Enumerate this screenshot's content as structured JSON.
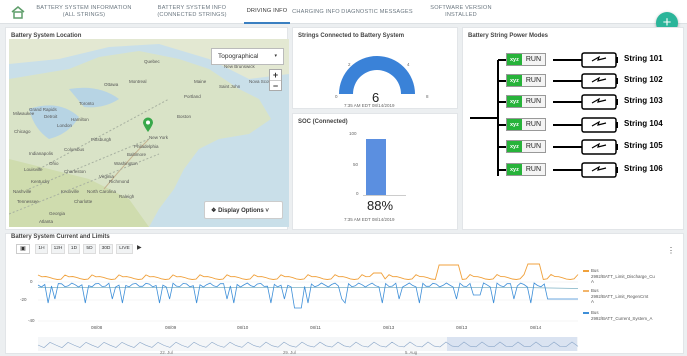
{
  "tabs": [
    {
      "label_1": "BATTERY SYSTEM INFORMATION",
      "label_2": "(ALL STRINGS)"
    },
    {
      "label_1": "BATTERY SYSTEM INFO",
      "label_2": "(CONNECTED STRINGS)"
    },
    {
      "label_1": "DRIVING INFO",
      "label_2": ""
    },
    {
      "label_1": "CHARGING INFO",
      "label_2": ""
    },
    {
      "label_1": "DIAGNOSTIC MESSAGES",
      "label_2": ""
    },
    {
      "label_1": "SOFTWARE VERSION INSTALLED",
      "label_2": ""
    }
  ],
  "fab_label": "+",
  "map_panel": {
    "title": "Battery System Location",
    "map_type": "Topographical",
    "zoom_in": "+",
    "zoom_out": "−",
    "display_options": "Display Options",
    "places": [
      "Toronto",
      "Ottawa",
      "Montreal",
      "Portland",
      "Boston",
      "New York",
      "Philadelphia",
      "Detroit",
      "Chicago",
      "Indianapolis",
      "Columbus",
      "Pittsburgh",
      "Washington",
      "Virginia",
      "North Carolina",
      "Ohio",
      "Kentucky",
      "Tennessee",
      "Georgia",
      "Louisville",
      "Baltimore",
      "Nashville",
      "Atlanta",
      "Charlotte",
      "Richmond",
      "Charleston",
      "Raleigh",
      "New Brunswick",
      "Nova Scotia",
      "Saint John",
      "Quebec",
      "Hamilton",
      "London",
      "Grand Rapids",
      "Milwaukee",
      "Maine",
      "Knoxville"
    ]
  },
  "strings_panel": {
    "title": "Strings Connected to Battery System",
    "value": "6",
    "gauge_ticks": [
      "0",
      "2",
      "4",
      "8"
    ],
    "timestamp": "7:35 AM EDT 08/14/2019"
  },
  "soc_panel": {
    "title": "SOC (Connected)",
    "ticks": [
      "100",
      "50",
      "0"
    ],
    "value": "88%",
    "timestamp": "7:35 AM EDT 08/14/2019"
  },
  "power_panel": {
    "title": "Battery String Power Modes",
    "tag": "xyz",
    "mode": "RUN",
    "strings": [
      "String 101",
      "String 102",
      "String 103",
      "String 104",
      "String 105",
      "String 106"
    ]
  },
  "chart_panel": {
    "title": "Battery System Current and Limits",
    "range_buttons": [
      "1H",
      "12H",
      "1D",
      "5D",
      "30D",
      "LIVE"
    ],
    "menu": "⋮",
    "yticks": [
      "0",
      "-20",
      "-40"
    ],
    "xticks": [
      "08/08",
      "08/09",
      "08/10",
      "08/11",
      "08/13",
      "08/13",
      "08/14"
    ],
    "nav_ticks": [
      "22. Jul",
      "29. Jul",
      "5. Aug"
    ],
    "legend": [
      {
        "l1": "Bus",
        "l2": "2992/BATT_Limit_Discharge_Cu",
        "l3": "A",
        "color": "#f0a13c"
      },
      {
        "l1": "Bus",
        "l2": "2992/BATT_Limit_RegenCrnt",
        "l3": "A",
        "color": "#f2b56c"
      },
      {
        "l1": "Bus",
        "l2": "2992/BATT_Current_System_A",
        "l3": "",
        "color": "#3e8fd8"
      }
    ]
  }
}
